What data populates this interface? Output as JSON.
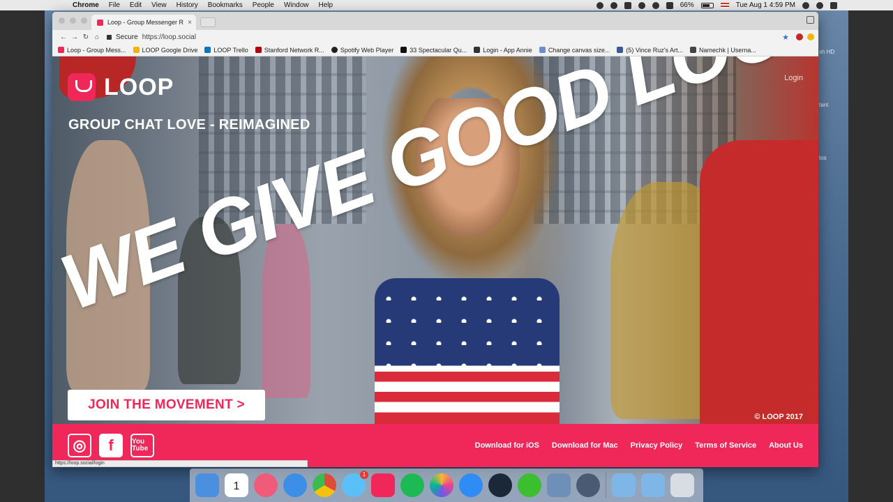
{
  "menubar": {
    "app_name": "Chrome",
    "items": [
      "File",
      "Edit",
      "View",
      "History",
      "Bookmarks",
      "People",
      "Window",
      "Help"
    ],
    "battery": "66%",
    "clock": "Tue Aug 1  4:59 PM"
  },
  "desktop": {
    "drive_label": "sh HD",
    "label_2": "tant",
    "label_3": "tos"
  },
  "browser": {
    "tab_title": "Loop - Group Messenger Rei",
    "tab_close": "×",
    "secure_label": "Secure",
    "url": "https://loop.social",
    "bookmarks": [
      {
        "label": "Loop - Group Mess...",
        "color": "#f0285a"
      },
      {
        "label": "LOOP Google Drive",
        "color": "#f4b400"
      },
      {
        "label": "LOOP Trello",
        "color": "#0079bf"
      },
      {
        "label": "Stanford Network R...",
        "color": "#b1040e"
      },
      {
        "label": "Spotify Web Player",
        "color": "#222222"
      },
      {
        "label": "33 Spectacular Qu...",
        "color": "#111111"
      },
      {
        "label": "Login - App Annie",
        "color": "#333333"
      },
      {
        "label": "Change canvas size...",
        "color": "#6a8fd0"
      },
      {
        "label": "(5) Vince Ruz's Art...",
        "color": "#3b5998"
      },
      {
        "label": "Namechk | Userna...",
        "color": "#444444"
      }
    ],
    "status_url": "https://loop.social/login"
  },
  "page": {
    "brand": "LOOP",
    "tagline": "GROUP CHAT LOVE - REIMAGINED",
    "login": "Login",
    "headline": "WE GIVE GOOD LOOP",
    "cta": "JOIN THE MOVEMENT >",
    "copyright": "© LOOP 2017",
    "accent_color": "#f0285a",
    "social": [
      {
        "name": "instagram-icon",
        "glyph": "◎"
      },
      {
        "name": "facebook-icon",
        "glyph": "f"
      },
      {
        "name": "youtube-icon",
        "glyph": "You Tube"
      }
    ],
    "footer_links": [
      "Download for iOS",
      "Download for Mac",
      "Privacy Policy",
      "Terms of Service",
      "About Us"
    ]
  },
  "dock": {
    "apps": [
      {
        "name": "finder-icon",
        "color": "#4a8fe0"
      },
      {
        "name": "calendar-icon",
        "color": "#ffffff",
        "text": "1"
      },
      {
        "name": "itunes-icon",
        "color": "#f05b7a"
      },
      {
        "name": "safari-icon",
        "color": "#3d8ee6"
      },
      {
        "name": "chrome-icon",
        "color": "#dd4b39"
      },
      {
        "name": "messages-icon",
        "color": "#5bc0f8",
        "badge": "1"
      },
      {
        "name": "loop-icon",
        "color": "#f0285a"
      },
      {
        "name": "spotify-icon",
        "color": "#1db954"
      },
      {
        "name": "photos-icon",
        "color": "#f7b731"
      },
      {
        "name": "app-store-icon",
        "color": "#2f8cf4"
      },
      {
        "name": "steam-icon",
        "color": "#1b2838"
      },
      {
        "name": "cloud-app-icon",
        "color": "#3bbf2f"
      },
      {
        "name": "preview-icon",
        "color": "#6d8fb8"
      },
      {
        "name": "quicktime-icon",
        "color": "#4a5a72"
      },
      {
        "name": "folder-icon",
        "color": "#7fb6e8"
      },
      {
        "name": "downloads-folder-icon",
        "color": "#7fb6e8"
      },
      {
        "name": "trash-icon",
        "color": "#d7dde3"
      }
    ]
  }
}
